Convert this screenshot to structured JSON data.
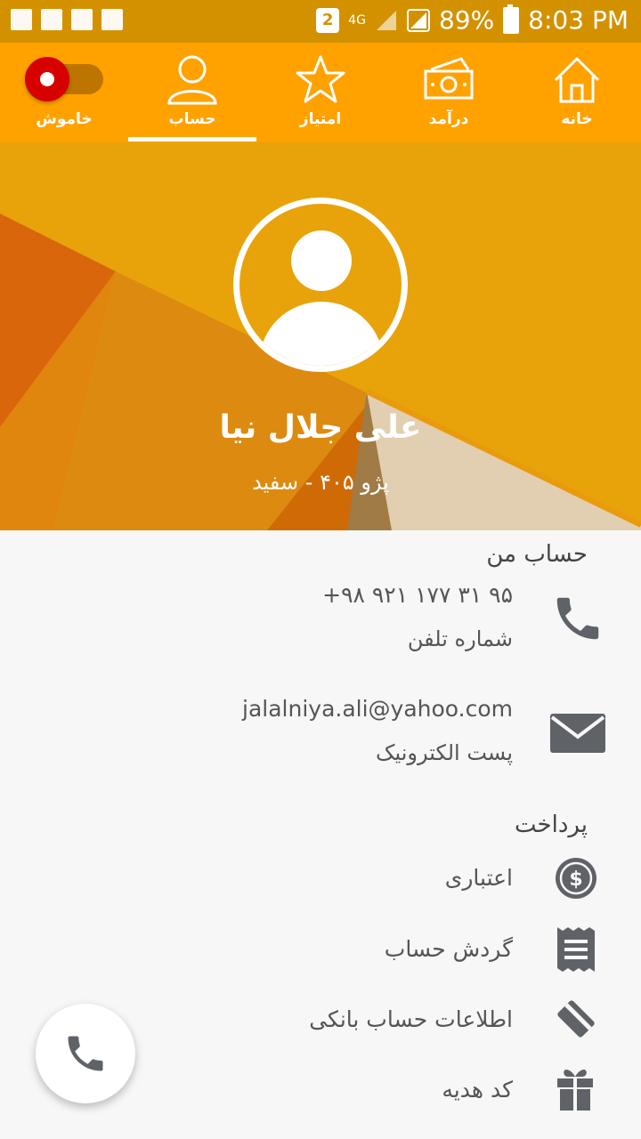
{
  "status_bar": {
    "badge": "2",
    "network": "4G",
    "battery": "89%",
    "time": "8:03 PM"
  },
  "nav": {
    "toggle_label": "خاموش",
    "items": [
      {
        "label": "حساب",
        "icon": "person-icon"
      },
      {
        "label": "امتیاز",
        "icon": "star-icon"
      },
      {
        "label": "درآمد",
        "icon": "money-icon"
      },
      {
        "label": "خانه",
        "icon": "home-icon"
      }
    ],
    "active_index": 0
  },
  "profile": {
    "name": "علی جلال نیا",
    "car": "پژو ۴۰۵ - سفید"
  },
  "account": {
    "title": "حساب من",
    "phone_value": "+۹۸ ۹۲۱ ۱۷۷ ۳۱ ۹۵",
    "phone_label": "شماره تلفن",
    "email_value": "jalalniya.ali@yahoo.com",
    "email_label": "پست الکترونیک"
  },
  "payment": {
    "title": "پرداخت",
    "items": [
      {
        "label": "اعتباری",
        "icon": "dollar-icon"
      },
      {
        "label": "گردش حساب",
        "icon": "receipt-icon"
      },
      {
        "label": "اطلاعات حساب بانکی",
        "icon": "card-icon"
      },
      {
        "label": "کد هدیه",
        "icon": "gift-icon"
      }
    ]
  },
  "colors": {
    "status_bar": "#d39100",
    "nav": "#ffa200",
    "hero": "#e8a30a",
    "icon": "#5f6368"
  }
}
